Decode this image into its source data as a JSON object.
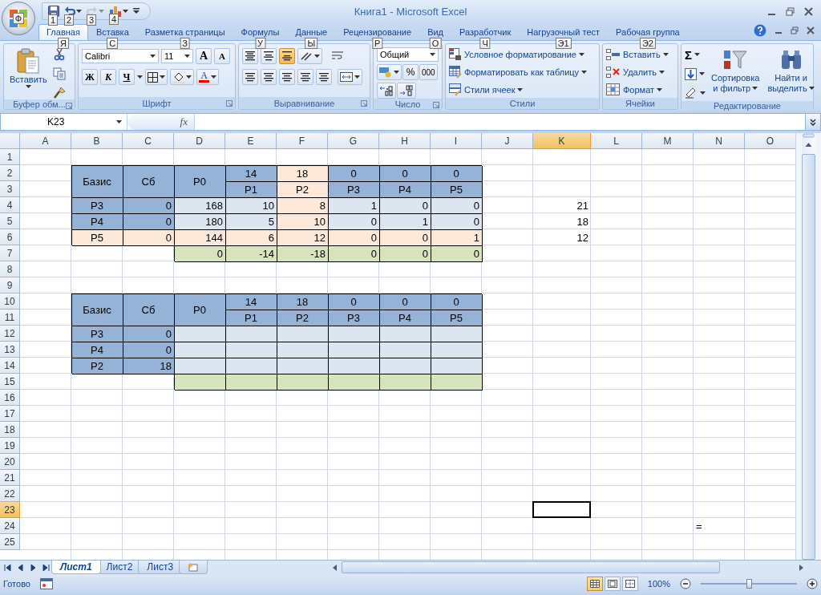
{
  "title_bar": {
    "title": "Книга1 - Microsoft Excel",
    "office_keytip": "Ф",
    "quick_access": [
      {
        "kind": "save",
        "keytip": "1",
        "disabled": false
      },
      {
        "kind": "undo",
        "keytip": "2",
        "disabled": false
      },
      {
        "kind": "redo",
        "keytip": "3",
        "disabled": true
      },
      {
        "kind": "chart",
        "keytip": "4",
        "disabled": false
      }
    ]
  },
  "tabs": [
    {
      "label": "Главная",
      "keytip": "Я",
      "selected": true
    },
    {
      "label": "Вставка",
      "keytip": "С",
      "selected": false
    },
    {
      "label": "Разметка страницы",
      "keytip": "З",
      "selected": false
    },
    {
      "label": "Формулы",
      "keytip": "У",
      "selected": false
    },
    {
      "label": "Данные",
      "keytip": "Ы",
      "selected": false
    },
    {
      "label": "Рецензирование",
      "keytip": "Р",
      "selected": false
    },
    {
      "label": "Вид",
      "keytip": "О",
      "selected": false
    },
    {
      "label": "Разработчик",
      "keytip": "Ч",
      "selected": false
    },
    {
      "label": "Нагрузочный тест",
      "keytip": "Э1",
      "selected": false
    },
    {
      "label": "Рабочая группа",
      "keytip": "Э2",
      "selected": false
    }
  ],
  "ribbon": {
    "groups": [
      {
        "kind": "clipboard",
        "label": "Буфер обм...",
        "paste": "Вставить"
      },
      {
        "kind": "font",
        "label": "Шрифт",
        "font": "Calibri",
        "size": "11",
        "grow": "A",
        "shrink": "A",
        "bold": "Ж",
        "italic": "К",
        "underline": "Ч",
        "font_color": "A"
      },
      {
        "kind": "alignment",
        "label": "Выравнивание",
        "vertical": [
          {
            "kind": "top",
            "selected": false
          },
          {
            "kind": "middle",
            "selected": false
          },
          {
            "kind": "bottom",
            "selected": true
          }
        ]
      },
      {
        "kind": "number",
        "label": "Число",
        "format": "Общий",
        "percent": "%",
        "thousands": "000"
      },
      {
        "kind": "styles",
        "label": "Стили",
        "commands": [
          "Условное форматирование",
          "Форматировать как таблицу",
          "Стили ячеек"
        ]
      },
      {
        "kind": "cells",
        "label": "Ячейки",
        "commands": [
          "Вставить",
          "Удалить",
          "Формат"
        ]
      },
      {
        "kind": "editing",
        "label": "Редактирование",
        "sum": "Σ",
        "sort": [
          "Сортировка",
          "и фильтр"
        ],
        "find": [
          "Найти и",
          "выделить"
        ]
      }
    ]
  },
  "formula_bar": {
    "name_box": "K23",
    "fx": "fx"
  },
  "sheet": {
    "columns": [
      {
        "label": "A",
        "selected": false
      },
      {
        "label": "B",
        "selected": false
      },
      {
        "label": "C",
        "selected": false
      },
      {
        "label": "D",
        "selected": false
      },
      {
        "label": "E",
        "selected": false
      },
      {
        "label": "F",
        "selected": false
      },
      {
        "label": "G",
        "selected": false
      },
      {
        "label": "H",
        "selected": false
      },
      {
        "label": "I",
        "selected": false
      },
      {
        "label": "J",
        "selected": false
      },
      {
        "label": "K",
        "selected": true
      },
      {
        "label": "L",
        "selected": false
      },
      {
        "label": "M",
        "selected": false
      },
      {
        "label": "N",
        "selected": false
      },
      {
        "label": "O",
        "selected": false
      }
    ],
    "rows": [
      {
        "label": "1",
        "selected": false
      },
      {
        "label": "2",
        "selected": false,
        "cells": [
          {
            "kind": "blank"
          },
          {
            "kind": "header",
            "text": "Базис",
            "color": "#95b3d7",
            "bordered": true
          },
          {
            "kind": "header",
            "text": "Сб",
            "color": "#95b3d7",
            "bordered": true
          },
          {
            "kind": "header",
            "text": "P0",
            "color": "#95b3d7",
            "bordered": true
          },
          {
            "kind": "label",
            "text": "14",
            "color": "#95b3d7",
            "bordered": true
          },
          {
            "kind": "label",
            "text": "18",
            "color": "#fde9d9",
            "bordered": true
          },
          {
            "kind": "label",
            "text": "0",
            "color": "#95b3d7",
            "bordered": true
          },
          {
            "kind": "label",
            "text": "0",
            "color": "#95b3d7",
            "bordered": true
          },
          {
            "kind": "label",
            "text": "0",
            "color": "#95b3d7",
            "bordered": true
          }
        ]
      },
      {
        "label": "3",
        "selected": false,
        "cells": [
          {
            "kind": "blank"
          },
          {
            "kind": "covered"
          },
          {
            "kind": "covered"
          },
          {
            "kind": "covered"
          },
          {
            "kind": "label",
            "text": "P1",
            "color": "#95b3d7",
            "bordered": true
          },
          {
            "kind": "label",
            "text": "P2",
            "color": "#fde9d9",
            "bordered": true
          },
          {
            "kind": "label",
            "text": "P3",
            "color": "#95b3d7",
            "bordered": true
          },
          {
            "kind": "label",
            "text": "P4",
            "color": "#95b3d7",
            "bordered": true
          },
          {
            "kind": "label",
            "text": "P5",
            "color": "#95b3d7",
            "bordered": true
          }
        ]
      },
      {
        "label": "4",
        "selected": false,
        "cells": [
          {
            "kind": "blank"
          },
          {
            "kind": "label",
            "text": "P3",
            "color": "#95b3d7",
            "bordered": true
          },
          {
            "kind": "number",
            "text": "0",
            "color": "#95b3d7",
            "bordered": true
          },
          {
            "kind": "number",
            "text": "168",
            "color": "#dce6f1",
            "bordered": true
          },
          {
            "kind": "number",
            "text": "10",
            "color": "#dce6f1",
            "bordered": true
          },
          {
            "kind": "number",
            "text": "8",
            "color": "#fde9d9",
            "bordered": true
          },
          {
            "kind": "number",
            "text": "1",
            "color": "#dce6f1",
            "bordered": true
          },
          {
            "kind": "number",
            "text": "0",
            "color": "#dce6f1",
            "bordered": true
          },
          {
            "kind": "number",
            "text": "0",
            "color": "#dce6f1",
            "bordered": true
          },
          {
            "kind": "blank"
          },
          {
            "kind": "number",
            "text": "21",
            "bordered": false
          }
        ]
      },
      {
        "label": "5",
        "selected": false,
        "cells": [
          {
            "kind": "blank"
          },
          {
            "kind": "label",
            "text": "P4",
            "color": "#95b3d7",
            "bordered": true
          },
          {
            "kind": "number",
            "text": "0",
            "color": "#95b3d7",
            "bordered": true
          },
          {
            "kind": "number",
            "text": "180",
            "color": "#dce6f1",
            "bordered": true
          },
          {
            "kind": "number",
            "text": "5",
            "color": "#dce6f1",
            "bordered": true
          },
          {
            "kind": "number",
            "text": "10",
            "color": "#fde9d9",
            "bordered": true
          },
          {
            "kind": "number",
            "text": "0",
            "color": "#dce6f1",
            "bordered": true
          },
          {
            "kind": "number",
            "text": "1",
            "color": "#dce6f1",
            "bordered": true
          },
          {
            "kind": "number",
            "text": "0",
            "color": "#dce6f1",
            "bordered": true
          },
          {
            "kind": "blank"
          },
          {
            "kind": "number",
            "text": "18",
            "bordered": false
          }
        ]
      },
      {
        "label": "6",
        "selected": false,
        "cells": [
          {
            "kind": "blank"
          },
          {
            "kind": "label",
            "text": "P5",
            "color": "#fde9d9",
            "bordered": true
          },
          {
            "kind": "number",
            "text": "0",
            "color": "#fde9d9",
            "bordered": true
          },
          {
            "kind": "number",
            "text": "144",
            "color": "#fde9d9",
            "bordered": true
          },
          {
            "kind": "number",
            "text": "6",
            "color": "#fde9d9",
            "bordered": true
          },
          {
            "kind": "number",
            "text": "12",
            "color": "#fde9d9",
            "bordered": true
          },
          {
            "kind": "number",
            "text": "0",
            "color": "#fde9d9",
            "bordered": true
          },
          {
            "kind": "number",
            "text": "0",
            "color": "#fde9d9",
            "bordered": true
          },
          {
            "kind": "number",
            "text": "1",
            "color": "#fde9d9",
            "bordered": true
          },
          {
            "kind": "blank"
          },
          {
            "kind": "number",
            "text": "12",
            "bordered": false
          }
        ]
      },
      {
        "label": "7",
        "selected": false,
        "cells": [
          {
            "kind": "blank"
          },
          {
            "kind": "blank"
          },
          {
            "kind": "blank"
          },
          {
            "kind": "number",
            "text": "0",
            "color": "#d8e4bc",
            "bordered": true
          },
          {
            "kind": "number",
            "text": "-14",
            "color": "#d8e4bc",
            "bordered": true
          },
          {
            "kind": "number",
            "text": "-18",
            "color": "#d8e4bc",
            "bordered": true
          },
          {
            "kind": "number",
            "text": "0",
            "color": "#d8e4bc",
            "bordered": true
          },
          {
            "kind": "number",
            "text": "0",
            "color": "#d8e4bc",
            "bordered": true
          },
          {
            "kind": "number",
            "text": "0",
            "color": "#d8e4bc",
            "bordered": true
          }
        ]
      },
      {
        "label": "8",
        "selected": false
      },
      {
        "label": "9",
        "selected": false
      },
      {
        "label": "10",
        "selected": false,
        "cells": [
          {
            "kind": "blank"
          },
          {
            "kind": "header",
            "text": "Базис",
            "color": "#95b3d7",
            "bordered": true
          },
          {
            "kind": "header",
            "text": "Сб",
            "color": "#95b3d7",
            "bordered": true
          },
          {
            "kind": "header",
            "text": "P0",
            "color": "#95b3d7",
            "bordered": true
          },
          {
            "kind": "label",
            "text": "14",
            "color": "#95b3d7",
            "bordered": true
          },
          {
            "kind": "label",
            "text": "18",
            "color": "#95b3d7",
            "bordered": true
          },
          {
            "kind": "label",
            "text": "0",
            "color": "#95b3d7",
            "bordered": true
          },
          {
            "kind": "label",
            "text": "0",
            "color": "#95b3d7",
            "bordered": true
          },
          {
            "kind": "label",
            "text": "0",
            "color": "#95b3d7",
            "bordered": true
          }
        ]
      },
      {
        "label": "11",
        "selected": false,
        "cells": [
          {
            "kind": "blank"
          },
          {
            "kind": "covered"
          },
          {
            "kind": "covered"
          },
          {
            "kind": "covered"
          },
          {
            "kind": "label",
            "text": "P1",
            "color": "#95b3d7",
            "bordered": true
          },
          {
            "kind": "label",
            "text": "P2",
            "color": "#95b3d7",
            "bordered": true
          },
          {
            "kind": "label",
            "text": "P3",
            "color": "#95b3d7",
            "bordered": true
          },
          {
            "kind": "label",
            "text": "P4",
            "color": "#95b3d7",
            "bordered": true
          },
          {
            "kind": "label",
            "text": "P5",
            "color": "#95b3d7",
            "bordered": true
          }
        ]
      },
      {
        "label": "12",
        "selected": false,
        "cells": [
          {
            "kind": "blank"
          },
          {
            "kind": "label",
            "text": "P3",
            "color": "#95b3d7",
            "bordered": true
          },
          {
            "kind": "number",
            "text": "0",
            "color": "#95b3d7",
            "bordered": true
          },
          {
            "kind": "number",
            "color": "#dce6f1",
            "bordered": true
          },
          {
            "kind": "number",
            "color": "#dce6f1",
            "bordered": true
          },
          {
            "kind": "number",
            "color": "#dce6f1",
            "bordered": true
          },
          {
            "kind": "number",
            "color": "#dce6f1",
            "bordered": true
          },
          {
            "kind": "number",
            "color": "#dce6f1",
            "bordered": true
          },
          {
            "kind": "number",
            "color": "#dce6f1",
            "bordered": true
          }
        ]
      },
      {
        "label": "13",
        "selected": false,
        "cells": [
          {
            "kind": "blank"
          },
          {
            "kind": "label",
            "text": "P4",
            "color": "#95b3d7",
            "bordered": true
          },
          {
            "kind": "number",
            "text": "0",
            "color": "#95b3d7",
            "bordered": true
          },
          {
            "kind": "number",
            "color": "#dce6f1",
            "bordered": true
          },
          {
            "kind": "number",
            "color": "#dce6f1",
            "bordered": true
          },
          {
            "kind": "number",
            "color": "#dce6f1",
            "bordered": true
          },
          {
            "kind": "number",
            "color": "#dce6f1",
            "bordered": true
          },
          {
            "kind": "number",
            "color": "#dce6f1",
            "bordered": true
          },
          {
            "kind": "number",
            "color": "#dce6f1",
            "bordered": true
          }
        ]
      },
      {
        "label": "14",
        "selected": false,
        "cells": [
          {
            "kind": "blank"
          },
          {
            "kind": "label",
            "text": "P2",
            "color": "#95b3d7",
            "bordered": true
          },
          {
            "kind": "number",
            "text": "18",
            "color": "#95b3d7",
            "bordered": true
          },
          {
            "kind": "number",
            "color": "#dce6f1",
            "bordered": true
          },
          {
            "kind": "number",
            "color": "#dce6f1",
            "bordered": true
          },
          {
            "kind": "number",
            "color": "#dce6f1",
            "bordered": true
          },
          {
            "kind": "number",
            "color": "#dce6f1",
            "bordered": true
          },
          {
            "kind": "number",
            "color": "#dce6f1",
            "bordered": true
          },
          {
            "kind": "number",
            "color": "#dce6f1",
            "bordered": true
          }
        ]
      },
      {
        "label": "15",
        "selected": false,
        "cells": [
          {
            "kind": "blank"
          },
          {
            "kind": "blank"
          },
          {
            "kind": "blank"
          },
          {
            "kind": "number",
            "color": "#d8e4bc",
            "bordered": true
          },
          {
            "kind": "number",
            "color": "#d8e4bc",
            "bordered": true
          },
          {
            "kind": "number",
            "color": "#d8e4bc",
            "bordered": true
          },
          {
            "kind": "number",
            "color": "#d8e4bc",
            "bordered": true
          },
          {
            "kind": "number",
            "color": "#d8e4bc",
            "bordered": true
          },
          {
            "kind": "number",
            "color": "#d8e4bc",
            "bordered": true
          }
        ]
      },
      {
        "label": "16",
        "selected": false
      },
      {
        "label": "17",
        "selected": false
      },
      {
        "label": "18",
        "selected": false
      },
      {
        "label": "19",
        "selected": false
      },
      {
        "label": "20",
        "selected": false
      },
      {
        "label": "21",
        "selected": false
      },
      {
        "label": "22",
        "selected": false
      },
      {
        "label": "23",
        "selected": true
      },
      {
        "label": "24",
        "selected": false,
        "cells": [
          {
            "kind": "blank"
          },
          {
            "kind": "blank"
          },
          {
            "kind": "blank"
          },
          {
            "kind": "blank"
          },
          {
            "kind": "blank"
          },
          {
            "kind": "blank"
          },
          {
            "kind": "blank"
          },
          {
            "kind": "blank"
          },
          {
            "kind": "blank"
          },
          {
            "kind": "blank"
          },
          {
            "kind": "blank"
          },
          {
            "kind": "blank"
          },
          {
            "kind": "blank"
          },
          {
            "kind": "text",
            "text": "=",
            "bordered": false
          }
        ]
      },
      {
        "label": "25",
        "selected": false
      }
    ]
  },
  "sheet_tabs": [
    {
      "label": "Лист1",
      "selected": true
    },
    {
      "label": "Лист2",
      "selected": false
    },
    {
      "label": "Лист3",
      "selected": false
    }
  ],
  "status_bar": {
    "status": "Готово",
    "views": [
      {
        "kind": "normal",
        "selected": true
      },
      {
        "kind": "layout",
        "selected": false
      },
      {
        "kind": "pagebreak",
        "selected": false
      }
    ],
    "zoom": "100%",
    "zoom_slider": {
      "level": 0.5
    }
  }
}
